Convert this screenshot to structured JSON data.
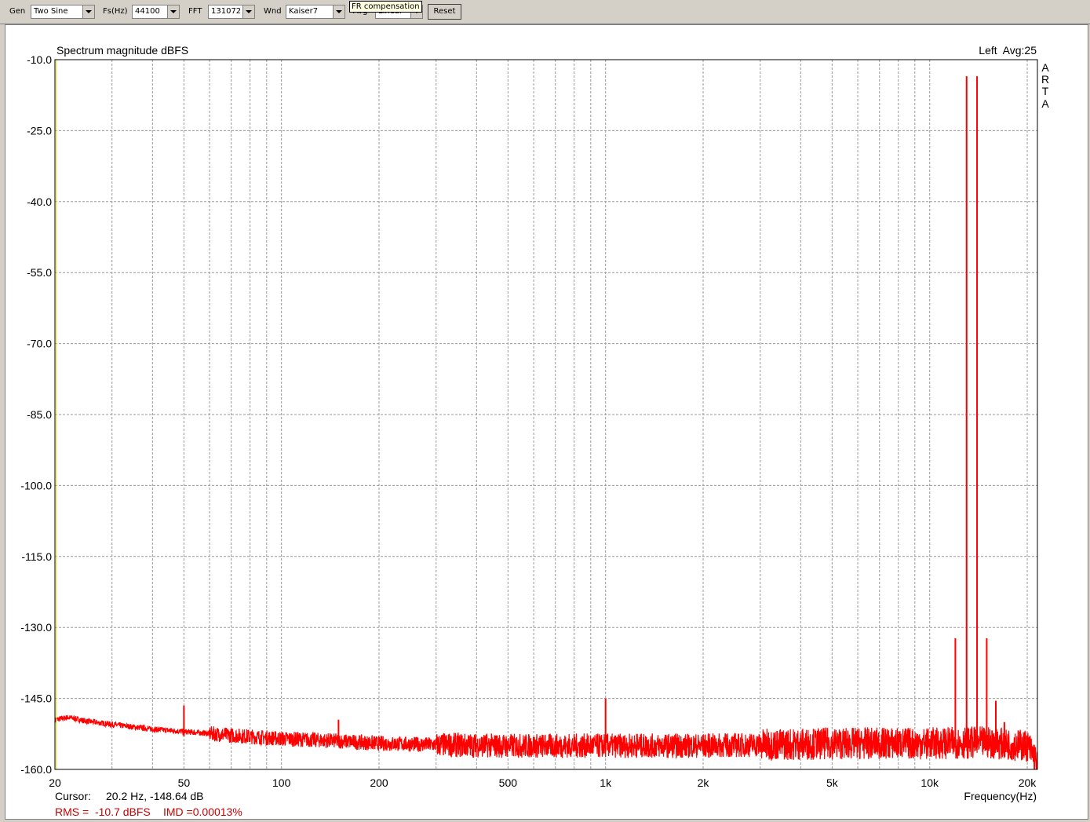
{
  "toolbar": {
    "gen_label": "Gen",
    "gen_value": "Two Sine",
    "fs_label": "Fs(Hz)",
    "fs_value": "44100",
    "fft_label": "FFT",
    "fft_value": "131072",
    "wnd_label": "Wnd",
    "wnd_value": "Kaiser7",
    "avg_label": "Avg",
    "avg_value": "Linear",
    "reset_label": "Reset",
    "tooltip": "FR compensation"
  },
  "chart_data": {
    "type": "line",
    "title": "Spectrum magnitude dBFS",
    "channel_info": "Left  Avg:25",
    "watermark": [
      "A",
      "R",
      "T",
      "A"
    ],
    "xlabel": "Frequency(Hz)",
    "x_scale": "log",
    "xlim": [
      20,
      21500
    ],
    "ylim": [
      -160,
      -10
    ],
    "x_ticks": [
      20,
      50,
      100,
      200,
      500,
      1000,
      2000,
      5000,
      10000,
      20000
    ],
    "x_tick_labels": [
      "20",
      "50",
      "100",
      "200",
      "500",
      "1k",
      "2k",
      "5k",
      "10k",
      "20k"
    ],
    "y_ticks": [
      -10,
      -25,
      -40,
      -55,
      -70,
      -85,
      -100,
      -115,
      -130,
      -145,
      -160
    ],
    "y_tick_labels": [
      "-10.0",
      "-25.0",
      "-40.0",
      "-55.0",
      "-70.0",
      "-85.0",
      "-100.0",
      "-115.0",
      "-130.0",
      "-145.0",
      "-160.0"
    ],
    "grid": true,
    "line_color": "#ff0000",
    "cursor_color": "#e0e000",
    "noise_floor": [
      [
        20,
        -149.5
      ],
      [
        22,
        -149.0
      ],
      [
        25,
        -149.8
      ],
      [
        30,
        -150.5
      ],
      [
        40,
        -151.5
      ],
      [
        50,
        -152.0
      ],
      [
        70,
        -152.8
      ],
      [
        100,
        -153.5
      ],
      [
        150,
        -154.0
      ],
      [
        200,
        -154.5
      ],
      [
        300,
        -154.8
      ],
      [
        500,
        -155.0
      ],
      [
        1000,
        -155.0
      ],
      [
        2000,
        -155.0
      ],
      [
        5000,
        -154.5
      ],
      [
        10000,
        -154.5
      ],
      [
        15000,
        -154.3
      ],
      [
        20000,
        -155.0
      ],
      [
        21000,
        -157.0
      ],
      [
        21500,
        -159.5
      ]
    ],
    "peaks": [
      [
        12000,
        -132.3
      ],
      [
        13000,
        -13.5
      ],
      [
        14000,
        -13.5
      ],
      [
        15000,
        -132.3
      ],
      [
        16000,
        -145.5
      ],
      [
        17000,
        -150.0
      ],
      [
        19000,
        -152.0
      ],
      [
        50,
        -146.5
      ],
      [
        150,
        -149.5
      ],
      [
        1000,
        -145.0
      ],
      [
        1250,
        -152.5
      ],
      [
        8000,
        -152.5
      ]
    ],
    "cursor": {
      "freq": 20.2,
      "level": -148.64
    },
    "annotations": {
      "cursor_label": "Cursor:",
      "cursor_value": "20.2 Hz, -148.64 dB",
      "rms": "RMS =  -10.7 dBFS",
      "imd": "IMD =0.00013%"
    }
  }
}
